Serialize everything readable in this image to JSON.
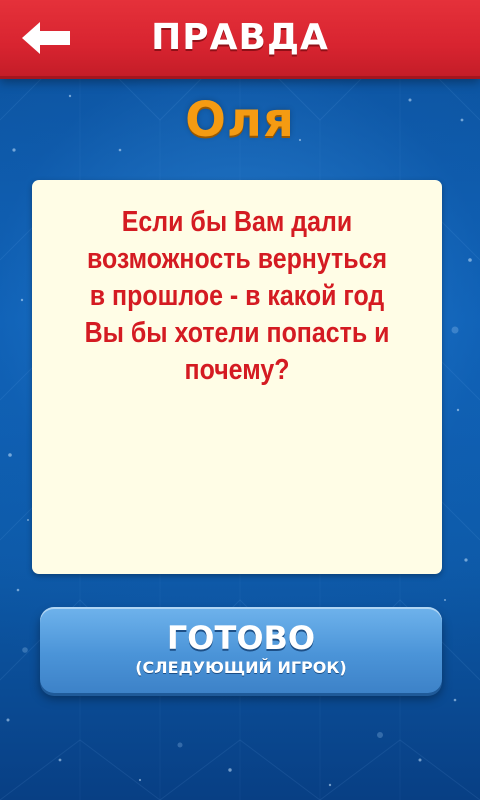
{
  "header": {
    "title": "ПРАВДА",
    "back_icon": "arrow-left-icon"
  },
  "player": {
    "name": "Оля"
  },
  "question": {
    "text": "Если бы Вам дали возможность вернуться в прошлое - в какой год Вы бы хотели попасть и почему?"
  },
  "done_button": {
    "label": "ГОТОВО",
    "sublabel": "(СЛЕДУЮЩИЙ ИГРОК)"
  },
  "colors": {
    "header_red": "#d82430",
    "background_blue": "#0d5aa6",
    "name_orange": "#f59b12",
    "card_cream": "#fffde6",
    "question_red": "#d41b22",
    "button_blue": "#4b94d8"
  }
}
